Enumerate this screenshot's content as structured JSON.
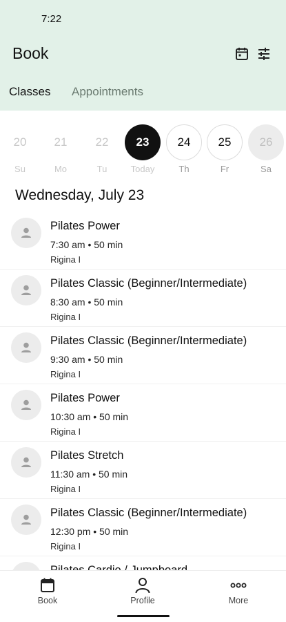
{
  "status_bar": {
    "time": "7:22"
  },
  "header": {
    "title": "Book",
    "tabs": [
      {
        "label": "Classes",
        "active": true
      },
      {
        "label": "Appointments",
        "active": false
      }
    ]
  },
  "icons": {
    "calendar": "calendar-icon",
    "filter": "filter-icon",
    "avatar": "person-icon",
    "more": "more-dots-icon"
  },
  "days": [
    {
      "num": "20",
      "label": "Su"
    },
    {
      "num": "21",
      "label": "Mo"
    },
    {
      "num": "22",
      "label": "Tu"
    },
    {
      "num": "23",
      "label": "Today"
    },
    {
      "num": "24",
      "label": "Th"
    },
    {
      "num": "25",
      "label": "Fr"
    },
    {
      "num": "26",
      "label": "Sa"
    }
  ],
  "date_heading": "Wednesday, July 23",
  "classes": [
    {
      "name": "Pilates Power",
      "time": "7:30 am • 50 min",
      "instructor": "Rigina I"
    },
    {
      "name": "Pilates Classic (Beginner/Intermediate)",
      "time": "8:30 am • 50 min",
      "instructor": "Rigina I"
    },
    {
      "name": "Pilates Classic (Beginner/Intermediate)",
      "time": "9:30 am • 50 min",
      "instructor": "Rigina I"
    },
    {
      "name": "Pilates Power",
      "time": "10:30 am • 50 min",
      "instructor": "Rigina I"
    },
    {
      "name": "Pilates Stretch",
      "time": "11:30 am • 50 min",
      "instructor": "Rigina I"
    },
    {
      "name": "Pilates Classic (Beginner/Intermediate)",
      "time": "12:30 pm • 50 min",
      "instructor": "Rigina I"
    },
    {
      "name": "Pilates Cardio / Jumpboard",
      "time": "",
      "instructor": ""
    }
  ],
  "nav": [
    {
      "label": "Book"
    },
    {
      "label": "Profile"
    },
    {
      "label": "More"
    }
  ],
  "colors": {
    "header_bg": "#e2f1e8",
    "today": "#111111",
    "inactive_tab": "#6a7a70"
  }
}
